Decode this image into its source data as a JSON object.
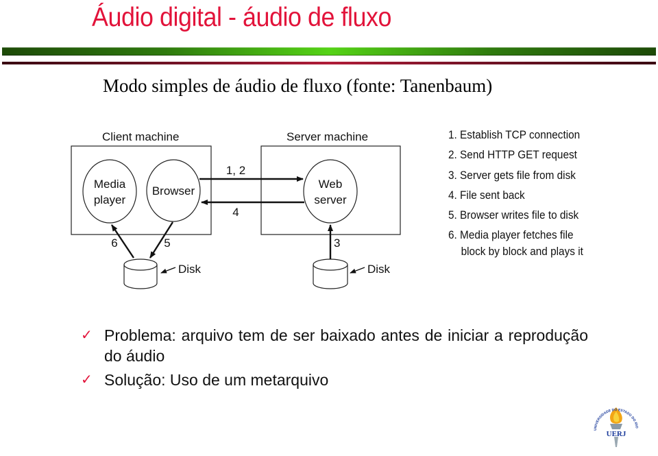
{
  "slide": {
    "title": "Áudio digital - áudio de fluxo",
    "subtitle": "Modo simples de áudio de fluxo (fonte: Tanenbaum)",
    "colors": {
      "title": "#e2133a",
      "bar_green": "#55d316",
      "bar_red": "#b01c38",
      "check": "#e2133a"
    }
  },
  "diagram": {
    "client": {
      "label": "Client machine",
      "media_player_line1": "Media",
      "media_player_line2": "player",
      "browser": "Browser",
      "disk": "Disk"
    },
    "server": {
      "label": "Server machine",
      "web_server_line1": "Web",
      "web_server_line2": "server",
      "disk": "Disk"
    },
    "arrow_labels": {
      "request": "1, 2",
      "response": "4",
      "server_disk": "3",
      "browser_to_disk": "5",
      "disk_to_player": "6"
    },
    "steps": [
      "1. Establish TCP connection",
      "2. Send HTTP GET request",
      "3. Server gets file from disk",
      "4. File sent back",
      "5. Browser writes file to disk",
      "6. Media player fetches file"
    ],
    "step6_continuation": "block by block and plays it"
  },
  "bullets": [
    {
      "icon": "checkmark-icon",
      "text": "Problema: arquivo tem de ser baixado antes de iniciar a reprodução do áudio"
    },
    {
      "icon": "checkmark-icon",
      "text": "Solução: Uso de um metarquivo"
    }
  ],
  "logo": {
    "name": "UERJ",
    "ring_text": "UNIVERSIDADE DO ESTADO DO RIO DE JANEIRO"
  }
}
